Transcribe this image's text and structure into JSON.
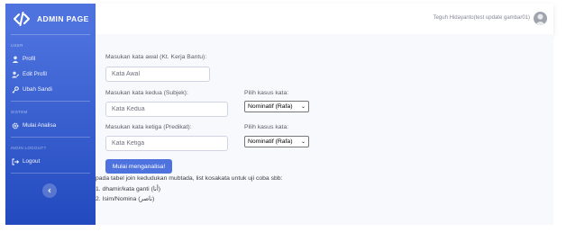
{
  "sidebar": {
    "brand": "ADMIN PAGE",
    "headings": {
      "user": "USER",
      "sistem": "SISTEM",
      "logout": "INGIN LOGOUT?"
    },
    "items": [
      {
        "label": "Profil",
        "icon": "user-icon"
      },
      {
        "label": "Edit Profil",
        "icon": "user-edit-icon"
      },
      {
        "label": "Ubah Sandi",
        "icon": "key-icon"
      },
      {
        "label": "Mulai Analisa",
        "icon": "cog-icon"
      },
      {
        "label": "Logout",
        "icon": "sign-out-icon"
      }
    ],
    "toggle_icon": "chevron-left-icon"
  },
  "topbar": {
    "user_name": "Teguh Hidayanto(test update gambar01)"
  },
  "form": {
    "kata_awal_label": "Masukan kata awal (Kt. Kerja Bantu):",
    "kata_awal_placeholder": "Kata Awal",
    "kata_kedua_label": "Masukan kata kedua (Subjek):",
    "kata_kedua_placeholder": "Kata Kedua",
    "kata_ketiga_label": "Masukan kata ketiga (Predikat):",
    "kata_ketiga_placeholder": "Kata Ketiga",
    "kasus_label_1": "Pilih kasus kata:",
    "kasus_value_1": "Nominatif (Rafa)",
    "kasus_label_2": "Pilih kasus kata:",
    "kasus_value_2": "Nominatif (Rafa)",
    "submit_label": "Mulai menganalisa!"
  },
  "notes": {
    "intro": "pada tabel join kedudukan mubtada, list kosakata untuk uji coba sbb:",
    "item1": "1. dhamir/kata ganti (أنا)",
    "item2": "2. Isim/Nomina (ناصر)"
  },
  "colors": {
    "primary": "#4e73df",
    "sidebar_bottom": "#224abe",
    "content_bg": "#f8f9fc"
  }
}
